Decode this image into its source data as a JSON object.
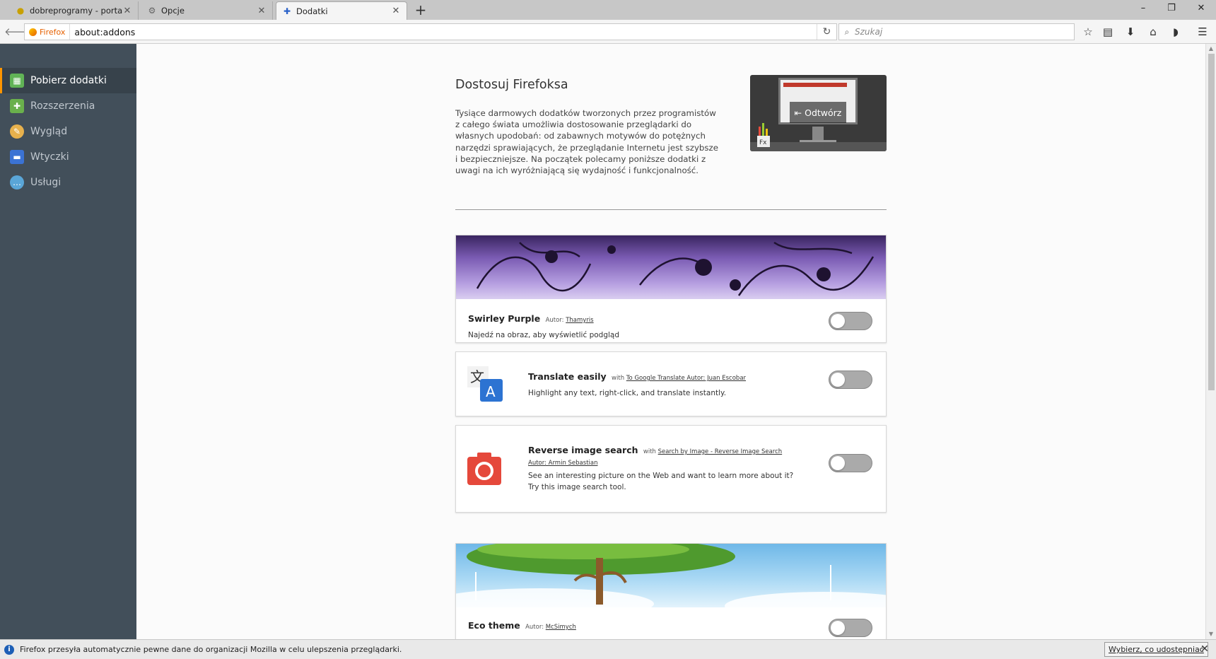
{
  "tabs": [
    {
      "title": "dobreprogramy - portal ni...",
      "icon": "dobreprogramy-favicon"
    },
    {
      "title": "Opcje",
      "icon": "gear-icon"
    },
    {
      "title": "Dodatki",
      "icon": "puzzle-icon"
    }
  ],
  "navbar": {
    "identity_label": "Firefox",
    "url": "about:addons",
    "search_placeholder": "Szukaj"
  },
  "sidebar": {
    "items": [
      {
        "label": "Pobierz dodatki",
        "icon": "get-addons-icon",
        "color": "#61b356"
      },
      {
        "label": "Rozszerzenia",
        "icon": "puzzle-icon",
        "color": "#6ab04c"
      },
      {
        "label": "Wygląd",
        "icon": "palette-icon",
        "color": "#e7b14d"
      },
      {
        "label": "Wtyczki",
        "icon": "plugin-icon",
        "color": "#3b73d4"
      },
      {
        "label": "Usługi",
        "icon": "chat-bubble-icon",
        "color": "#5aa6d8"
      }
    ]
  },
  "hero": {
    "title": "Dostosuj Firefoksa",
    "text": "Tysiące darmowych dodatków tworzonych przez programistów z całego świata umożliwia dostosowanie przeglądarki do własnych upodobań: od zabawnych motywów do potężnych narzędzi sprawiających, że przeglądanie Internetu jest szybsze i bezpieczniejsze. Na początek polecamy poniższe dodatki z uwagi na ich wyróżniającą się wydajność i funkcjonalność.",
    "video_label": "Odtwórz"
  },
  "addons": [
    {
      "name": "Swirley Purple",
      "meta_prefix": "Autor:",
      "author": "Thamyris",
      "description": "Najedź na obraz, aby wyświetlić podgląd"
    },
    {
      "name": "Translate easily",
      "meta_prefix": "with",
      "author": "To Google Translate Autor: Juan Escobar",
      "description": "Highlight any text, right-click, and translate instantly."
    },
    {
      "name": "Reverse image search",
      "meta_prefix": "with",
      "author": "Search by Image - Reverse Image Search Autor: Armin Sebastian",
      "description": "See an interesting picture on the Web and want to learn more about it? Try this image search tool."
    },
    {
      "name": "Eco theme",
      "meta_prefix": "Autor:",
      "author": "McSimych",
      "description": ""
    }
  ],
  "notification": {
    "text": "Firefox przesyła automatycznie pewne dane do organizacji Mozilla w celu ulepszenia przeglądarki.",
    "button": "Wybierz, co udostępniać"
  },
  "colors": {
    "accent": "#ff9500",
    "sidebar_bg": "#424f5a",
    "camera_red": "#e5483b",
    "translate_blue": "#2c73d2"
  }
}
